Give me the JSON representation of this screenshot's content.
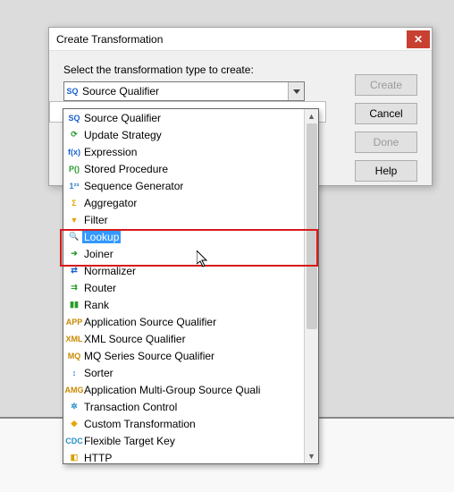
{
  "window": {
    "title": "Create Transformation",
    "close_glyph": "✕"
  },
  "prompt": "Select the transformation type to create:",
  "combo": {
    "selected": "Source Qualifier",
    "selected_icon": "SQ"
  },
  "buttons": {
    "create": "Create",
    "cancel": "Cancel",
    "done": "Done",
    "help": "Help"
  },
  "items": [
    {
      "icon": "SQ",
      "color": "#1560d0",
      "label": "Source Qualifier"
    },
    {
      "icon": "⟳",
      "color": "#2a9a2a",
      "label": "Update Strategy"
    },
    {
      "icon": "f(x)",
      "color": "#1560d0",
      "label": "Expression"
    },
    {
      "icon": "P()",
      "color": "#2a9a2a",
      "label": "Stored Procedure"
    },
    {
      "icon": "1²³",
      "color": "#3780c8",
      "label": "Sequence Generator"
    },
    {
      "icon": "Σ",
      "color": "#e6a500",
      "label": "Aggregator"
    },
    {
      "icon": "▼",
      "color": "#e6a500",
      "label": "Filter"
    },
    {
      "icon": "🔍",
      "color": "#3b84d8",
      "label": "Lookup",
      "selected": true
    },
    {
      "icon": "➜",
      "color": "#2a9a2a",
      "label": "Joiner"
    },
    {
      "icon": "⇄",
      "color": "#1560d0",
      "label": "Normalizer"
    },
    {
      "icon": "⇉",
      "color": "#2a9a2a",
      "label": "Router"
    },
    {
      "icon": "▮▮",
      "color": "#2a9a2a",
      "label": "Rank"
    },
    {
      "icon": "APP",
      "color": "#c88a00",
      "label": "Application Source Qualifier"
    },
    {
      "icon": "XML",
      "color": "#c88a00",
      "label": "XML Source Qualifier"
    },
    {
      "icon": "MQ",
      "color": "#c88a00",
      "label": "MQ Series Source Qualifier"
    },
    {
      "icon": "↕",
      "color": "#1560d0",
      "label": "Sorter"
    },
    {
      "icon": "AMG",
      "color": "#c88a00",
      "label": "Application Multi-Group Source Quali"
    },
    {
      "icon": "✲",
      "color": "#2a90c8",
      "label": "Transaction Control"
    },
    {
      "icon": "◆",
      "color": "#e6a500",
      "label": "Custom Transformation"
    },
    {
      "icon": "CDC",
      "color": "#2a90c8",
      "label": "Flexible Target Key"
    },
    {
      "icon": "◧",
      "color": "#d8a000",
      "label": "HTTP"
    }
  ]
}
